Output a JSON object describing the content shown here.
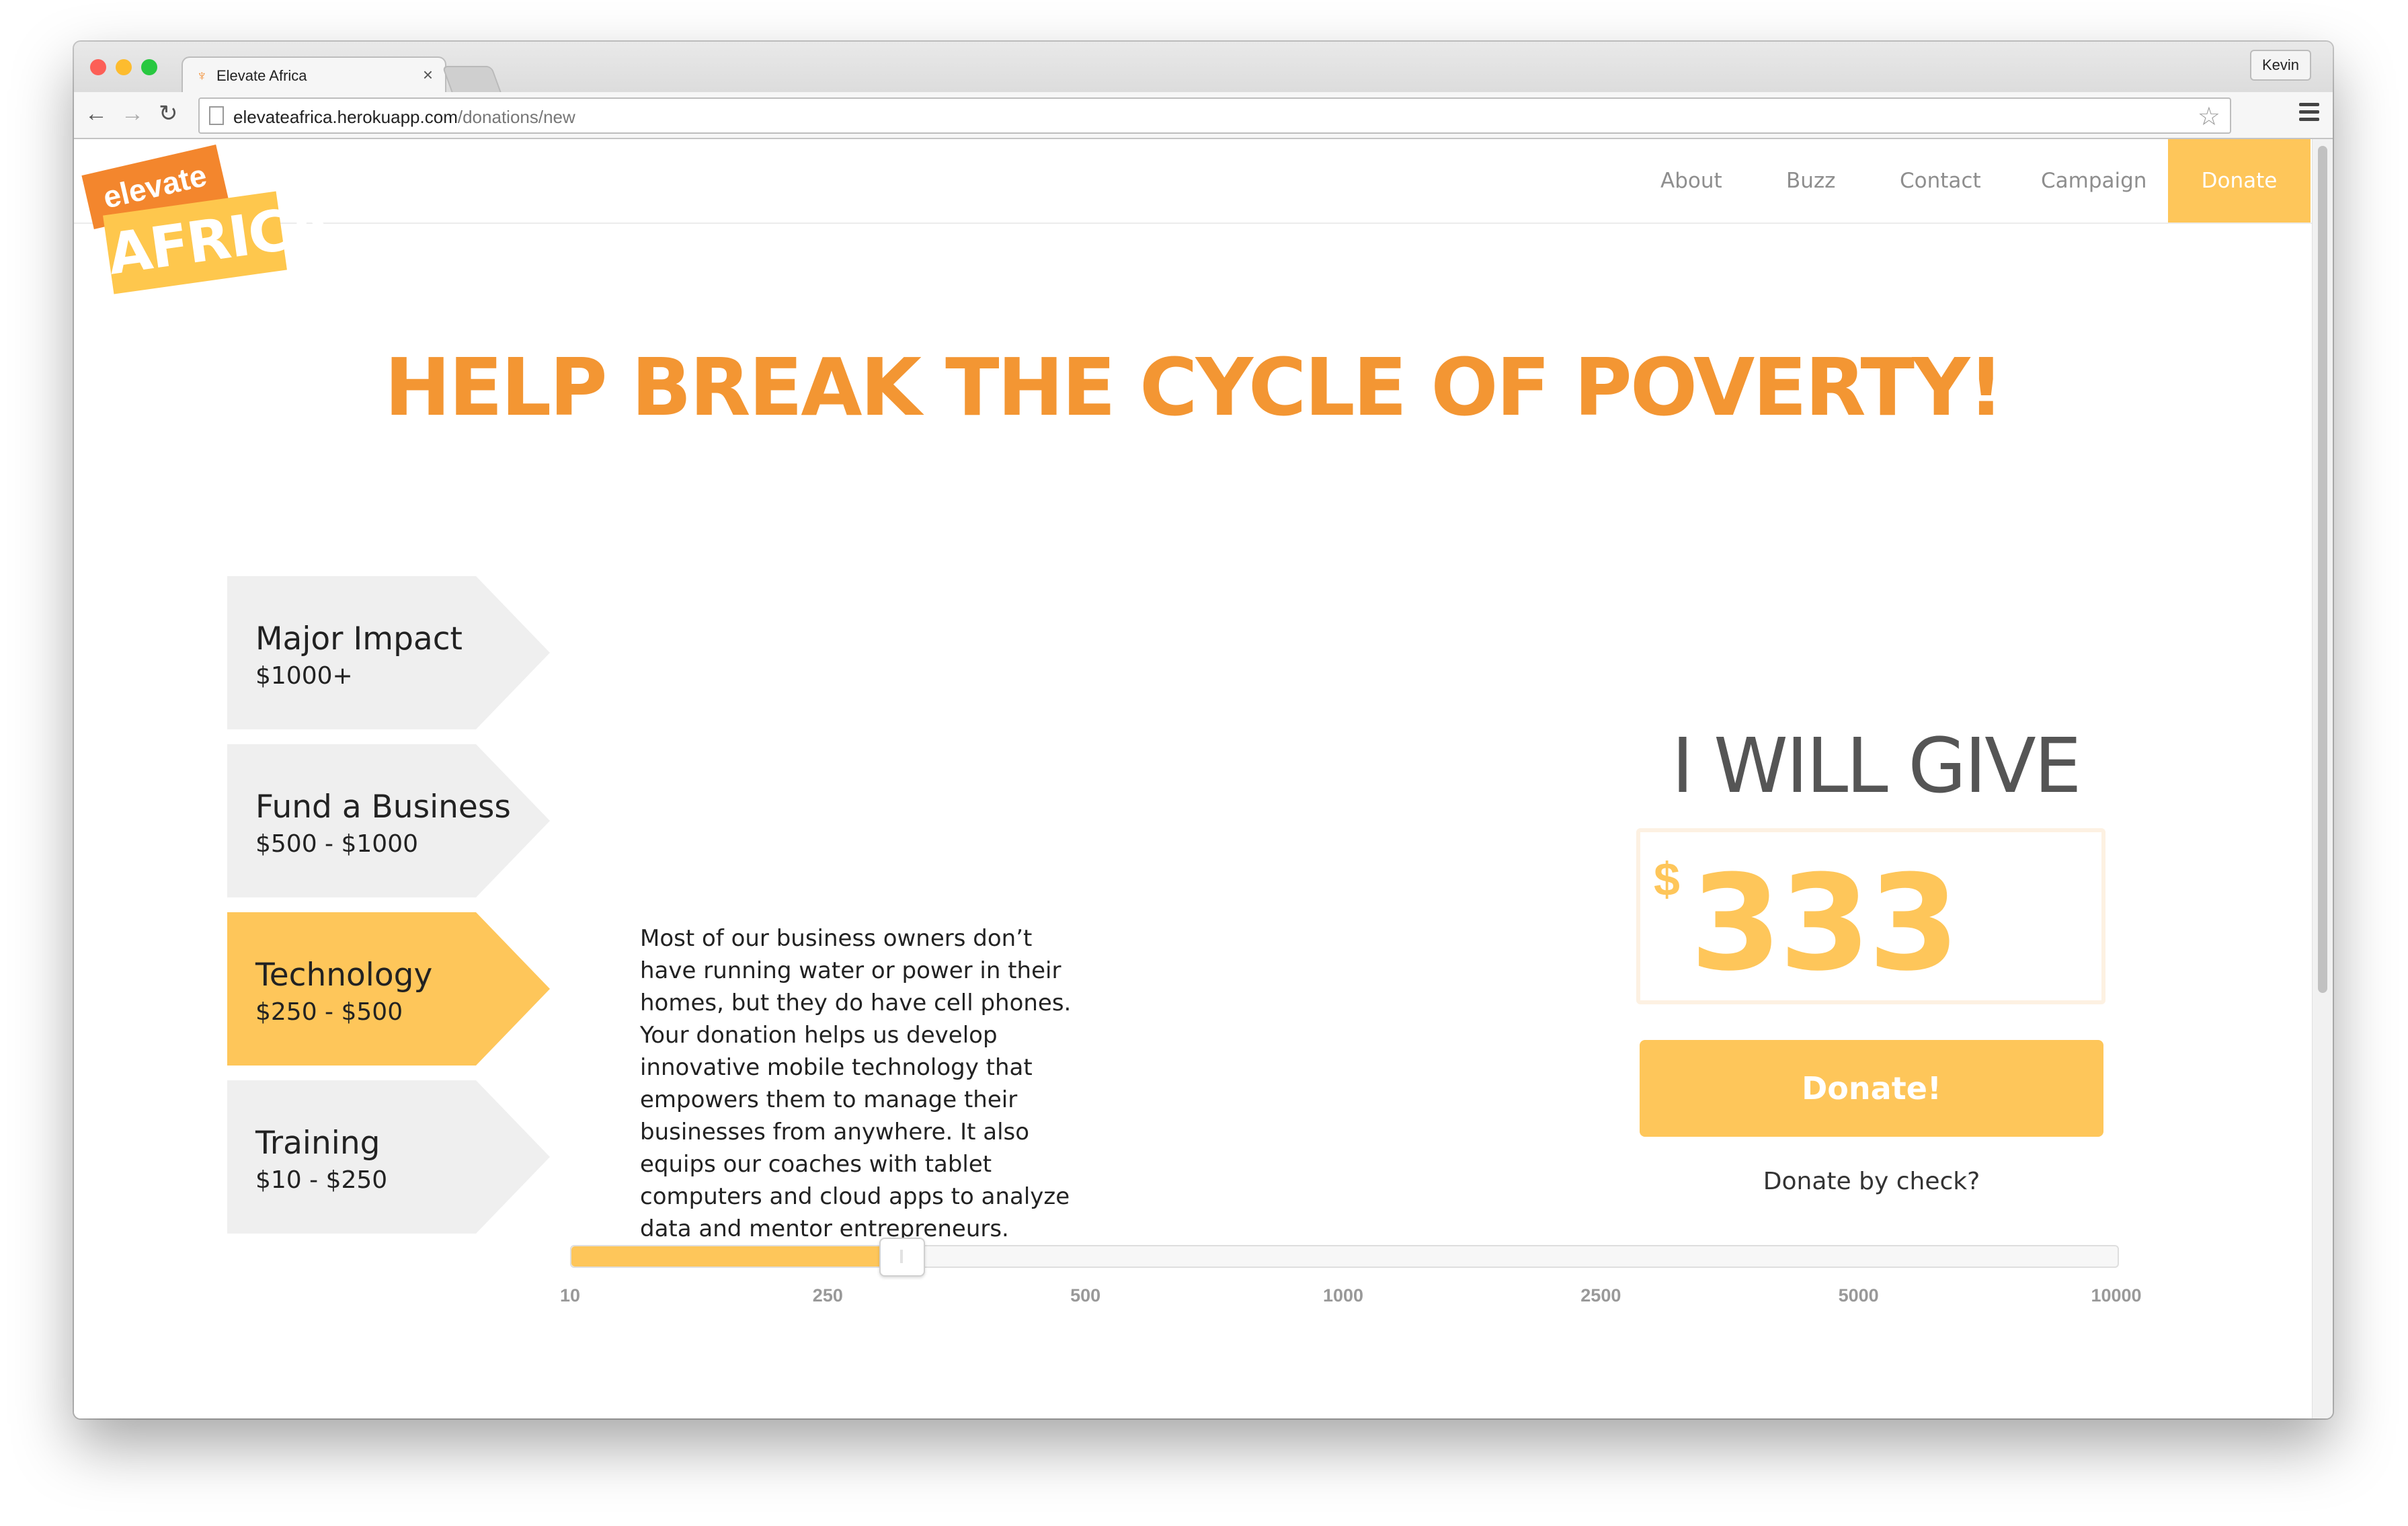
{
  "browser": {
    "tab_title": "Elevate Africa",
    "tab_close": "×",
    "profile_name": "Kevin",
    "url_host": "elevateafrica.herokuapp.com",
    "url_path": "/donations/new"
  },
  "colors": {
    "accent_orange": "#f39633",
    "accent_yellow": "#fec65a",
    "tier_inactive": "#efefef"
  },
  "logo": {
    "top": "elevate",
    "bottom": "AFRICA"
  },
  "nav": {
    "items": [
      {
        "label": "About"
      },
      {
        "label": "Buzz"
      },
      {
        "label": "Contact"
      },
      {
        "label": "Campaign"
      }
    ],
    "donate_label": "Donate"
  },
  "headline": "HELP BREAK THE CYCLE OF POVERTY!",
  "tiers": [
    {
      "name": "Major Impact",
      "range": "$1000+",
      "selected": false
    },
    {
      "name": "Fund a Business",
      "range": "$500 - $1000",
      "selected": false
    },
    {
      "name": "Technology",
      "range": "$250 - $500",
      "selected": true
    },
    {
      "name": "Training",
      "range": "$10 - $250",
      "selected": false
    }
  ],
  "description": "Most of our business owners don’t have running water or power in their homes, but they do have cell phones. Your donation helps us develop innovative mobile technology that empowers them to manage their businesses from anywhere. It also equips our coaches with tablet computers and cloud apps to analyze data and mentor entrepreneurs.",
  "give": {
    "label": "I WILL GIVE",
    "currency": "$",
    "amount": "333",
    "donate_button": "Donate!",
    "check_link": "Donate by check?"
  },
  "slider": {
    "ticks": [
      "10",
      "250",
      "500",
      "1000",
      "2500",
      "5000",
      "10000"
    ],
    "value": 333,
    "fill_fraction": 0.213
  }
}
